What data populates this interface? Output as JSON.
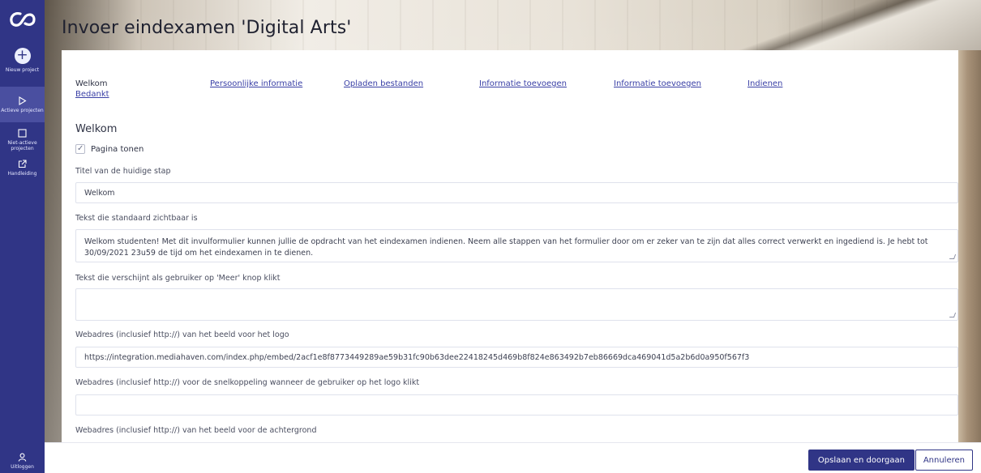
{
  "sidebar": {
    "new_project": "Nieuw project",
    "active_projects": "Actieve projecten",
    "inactive_projects": "Niet-actieve projecten",
    "manual": "Handleiding",
    "logout": "Uitloggen",
    "accent_color": "#303586"
  },
  "page": {
    "title": "Invoer eindexamen 'Digital Arts'"
  },
  "steps": [
    {
      "label": "Welkom",
      "current": true
    },
    {
      "label": "Persoonlijke informatie",
      "current": false
    },
    {
      "label": "Opladen bestanden",
      "current": false
    },
    {
      "label": "Informatie toevoegen",
      "current": false
    },
    {
      "label": "Informatie toevoegen",
      "current": false
    },
    {
      "label": "Indienen",
      "current": false
    },
    {
      "label": "Bedankt",
      "current": false
    }
  ],
  "form": {
    "section_title": "Welkom",
    "show_page": {
      "label": "Pagina tonen",
      "checked": true
    },
    "step_title": {
      "label": "Titel van de huidige stap",
      "value": "Welkom"
    },
    "default_text": {
      "label": "Tekst die standaard zichtbaar is",
      "value": "Welkom studenten! Met dit invulformulier kunnen jullie de opdracht van het eindexamen indienen. Neem alle stappen van het formulier door om er zeker van te zijn dat alles correct verwerkt en ingediend is. Je hebt tot 30/09/2021 23u59 de tijd om het eindexamen in te dienen."
    },
    "more_text": {
      "label": "Tekst die verschijnt als gebruiker op 'Meer' knop klikt",
      "value": ""
    },
    "logo_url": {
      "label": "Webadres (inclusief http://) van het beeld voor het logo",
      "value": "https://integration.mediahaven.com/index.php/embed/2acf1e8f8773449289ae59b31fc90b63dee22418245d469b8f824e863492b7eb86669dca469041d5a2b6d0a950f567f3"
    },
    "logo_link": {
      "label": "Webadres (inclusief http://) voor de snelkoppeling wanneer de gebruiker op het logo klikt",
      "value": ""
    },
    "background_url": {
      "label": "Webadres (inclusief http://) van het beeld voor de achtergrond"
    }
  },
  "actions": {
    "save": "Opslaan en doorgaan",
    "cancel": "Annuleren"
  }
}
